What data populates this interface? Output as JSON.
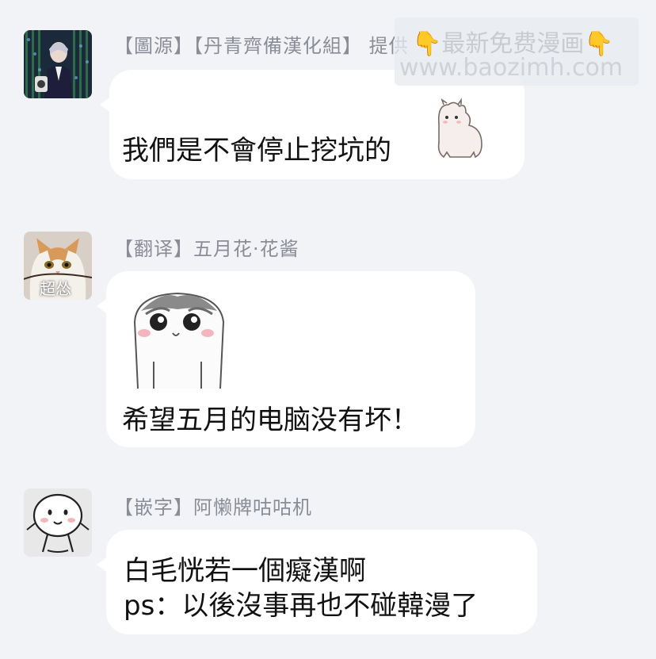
{
  "watermark": {
    "line1": "最新免费漫画",
    "line2": "www.baozimh.com",
    "hand_icon": "👇"
  },
  "messages": [
    {
      "sender": "【圖源】【丹青齊備漢化組】 提供",
      "text": "我們是不會停止挖坑的",
      "sticker": "alpaca-sticker"
    },
    {
      "sender": "【翻译】五月花·花酱",
      "avatar_text": "超怂",
      "sticker": "hamster-sticker",
      "text": "希望五月的电脑没有坏！"
    },
    {
      "sender": "【嵌字】阿懒牌咕咕机",
      "line1": "白毛恍若一個癡漢啊",
      "line2": "ps：以後沒事再也不碰韓漫了"
    }
  ]
}
